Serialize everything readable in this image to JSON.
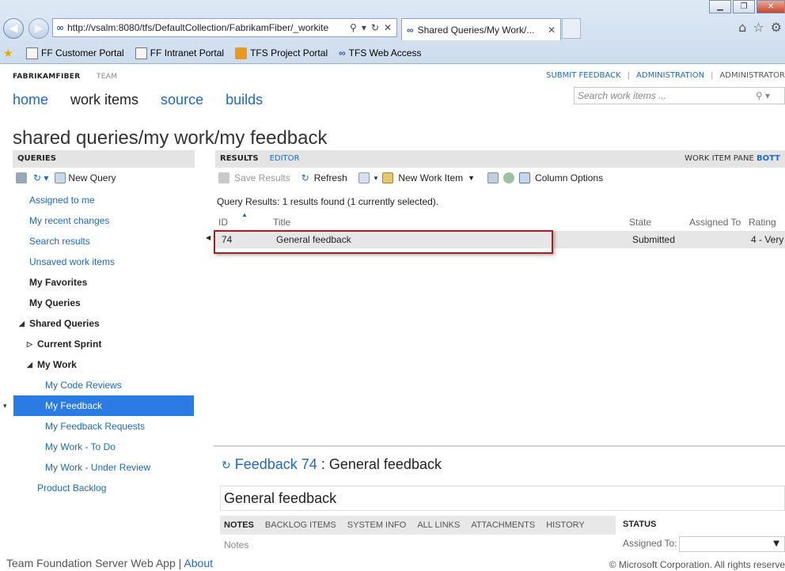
{
  "browser": {
    "url": "http://vsalm:8080/tfs/DefaultCollection/FabrikamFiber/_workite",
    "tab_title": "Shared Queries/My Work/...",
    "favorites": [
      "FF Customer Portal",
      "FF Intranet Portal",
      "TFS Project Portal",
      "TFS Web Access"
    ]
  },
  "header": {
    "org": "FABRIKAMFIBER",
    "team": "TEAM",
    "links": [
      "SUBMIT FEEDBACK",
      "ADMINISTRATION",
      "ADMINISTRATOR"
    ],
    "nav": [
      "home",
      "work items",
      "source",
      "builds"
    ],
    "search_placeholder": "Search work items ..."
  },
  "page_title": "shared queries/my work/my feedback",
  "left": {
    "header": "QUERIES",
    "new_query": "New Query",
    "tree": [
      {
        "label": "Assigned to me"
      },
      {
        "label": "My recent changes"
      },
      {
        "label": "Search results"
      },
      {
        "label": "Unsaved work items"
      },
      {
        "label": "My Favorites"
      },
      {
        "label": "My Queries"
      },
      {
        "label": "Shared Queries"
      },
      {
        "label": "Current Sprint"
      },
      {
        "label": "My Work"
      },
      {
        "label": "My Code Reviews"
      },
      {
        "label": "My Feedback"
      },
      {
        "label": "My Feedback Requests"
      },
      {
        "label": "My Work - To Do"
      },
      {
        "label": "My Work - Under Review"
      },
      {
        "label": "Product Backlog"
      }
    ]
  },
  "right": {
    "tab_results": "RESULTS",
    "tab_editor": "EDITOR",
    "pane_label": "WORK ITEM PANE",
    "pane_value": "BOTT",
    "toolbar": {
      "save": "Save Results",
      "refresh": "Refresh",
      "new_work_item": "New Work Item",
      "column_options": "Column Options"
    },
    "query_info": "Query Results: 1 results found (1 currently selected).",
    "columns": [
      "ID",
      "Title",
      "State",
      "Assigned To",
      "Rating"
    ],
    "rows": [
      {
        "id": "74",
        "title": "General feedback",
        "state": "Submitted",
        "assigned": "",
        "rating": "4 - Very"
      }
    ]
  },
  "workitem": {
    "type": "Feedback 74",
    "sep": ":",
    "title": "General feedback",
    "title_field": "General feedback",
    "tabs": [
      "NOTES",
      "BACKLOG ITEMS",
      "SYSTEM INFO",
      "ALL LINKS",
      "ATTACHMENTS",
      "HISTORY"
    ],
    "notes_label": "Notes",
    "status_label": "STATUS",
    "assigned_label": "Assigned To:"
  },
  "footer": {
    "app": "Team Foundation Server Web App",
    "sep": "|",
    "about": "About",
    "copyright": "© Microsoft Corporation. All rights reserve"
  }
}
